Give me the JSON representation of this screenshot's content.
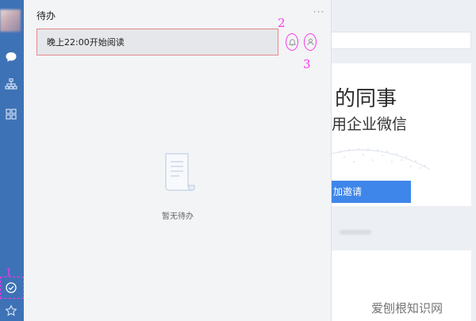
{
  "todo": {
    "title": "待办",
    "more_label": "···",
    "items": [
      {
        "text": "晚上22:00开始阅读"
      }
    ],
    "empty_text": "暂无待办"
  },
  "annotations": {
    "one": "1",
    "two": "2",
    "three": "3"
  },
  "background": {
    "title": "的同事",
    "subtitle": "用企业微信",
    "invite_label": "加邀请"
  },
  "watermark": "爱刨根知识网",
  "colors": {
    "sidebar": "#3e72b6",
    "annotation": "#ff33ee",
    "invite_button": "#3f86ea",
    "todo_item_border": "#e4898c"
  },
  "icons": {
    "sidebar": [
      "chat-icon",
      "org-chart-icon",
      "apps-grid-icon",
      "todo-check-icon",
      "star-icon"
    ],
    "todo_controls": [
      "bell-icon",
      "person-icon"
    ]
  }
}
